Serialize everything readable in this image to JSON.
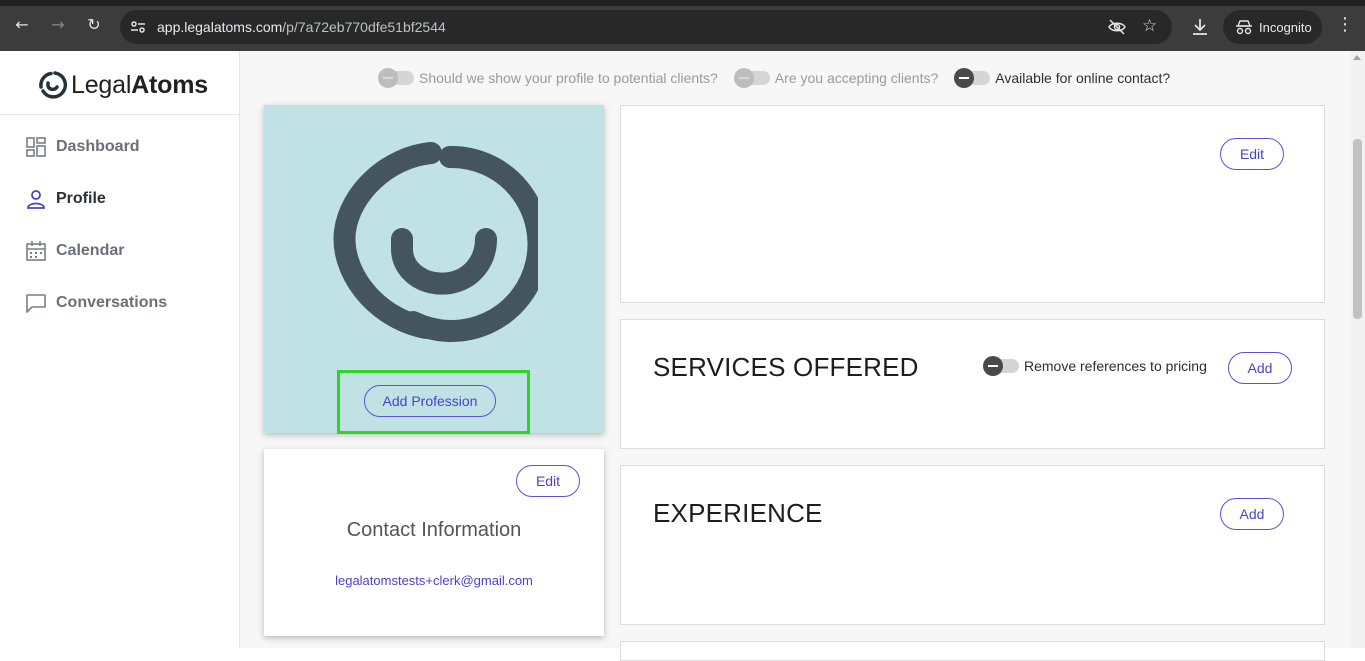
{
  "browser": {
    "url_host": "app.legalatoms.com",
    "url_path": "/p/7a72eb770dfe51bf2544",
    "incognito_label": "Incognito",
    "icons": [
      "back-arrow-icon",
      "forward-arrow-icon",
      "reload-icon",
      "site-info-icon",
      "eye-off-icon",
      "star-icon",
      "download-icon",
      "incognito-icon",
      "kebab-menu-icon"
    ]
  },
  "brand": {
    "name_light": "Legal",
    "name_bold": "Atoms"
  },
  "sidebar": {
    "items": [
      {
        "label": "Dashboard",
        "icon": "dashboard-icon",
        "active": false
      },
      {
        "label": "Profile",
        "icon": "person-icon",
        "active": true
      },
      {
        "label": "Calendar",
        "icon": "calendar-icon",
        "active": false
      },
      {
        "label": "Conversations",
        "icon": "chat-icon",
        "active": false
      }
    ]
  },
  "toggles": [
    {
      "label": "Should we show your profile to potential clients?",
      "state": "off-disabled"
    },
    {
      "label": "Are you accepting clients?",
      "state": "off-disabled"
    },
    {
      "label": "Available for online contact?",
      "state": "off"
    }
  ],
  "profile_card": {
    "add_profession_label": "Add Profession"
  },
  "contact": {
    "edit_label": "Edit",
    "title": "Contact Information",
    "email": "legalatomstests+clerk@gmail.com"
  },
  "bio_card": {
    "edit_label": "Edit"
  },
  "services": {
    "title": "SERVICES OFFERED",
    "toggle_label": "Remove references to pricing",
    "add_label": "Add"
  },
  "experience": {
    "title": "EXPERIENCE",
    "add_label": "Add"
  },
  "colors": {
    "accent": "#4a43c9",
    "avatar_bg": "#c0e2e5",
    "logo_mark": "#455560",
    "highlight": "#2fd61f"
  }
}
